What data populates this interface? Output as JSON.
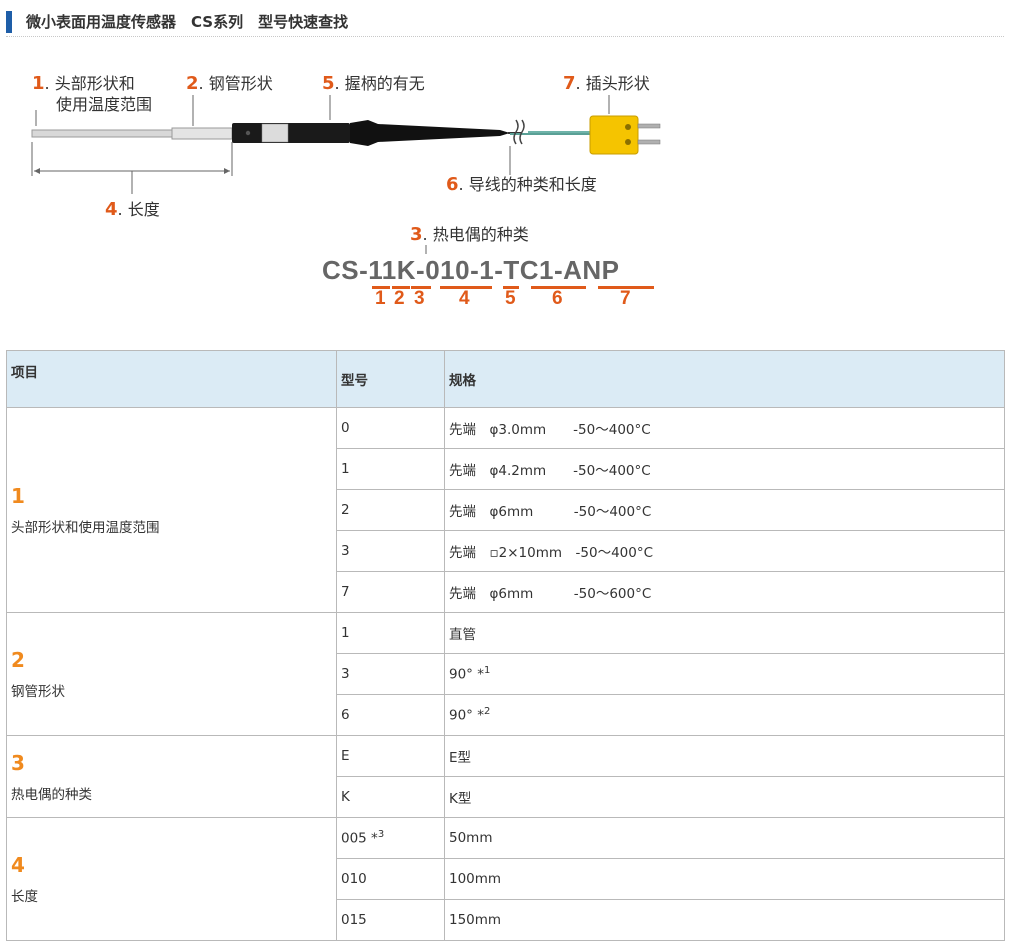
{
  "header": {
    "title": "微小表面用温度传感器　CS系列　型号快速查找"
  },
  "diagram": {
    "label1_num": "1",
    "label1_line1": "头部形状和",
    "label1_line2": "使用温度范围",
    "label2_num": "2",
    "label2_text": "钢管形状",
    "label5_num": "5",
    "label5_text": "握柄的有无",
    "label7_num": "7",
    "label7_text": "插头形状",
    "label4_num": "4",
    "label4_text": "长度",
    "label6_num": "6",
    "label6_text": "导线的种类和长度",
    "label3_num": "3",
    "label3_text": "热电偶的种类",
    "model_code": "CS-11K-010-1-TC1-ANP",
    "segment_numbers": [
      "1",
      "2",
      "3",
      "4",
      "5",
      "6",
      "7"
    ]
  },
  "table": {
    "headers": {
      "item": "项目",
      "model": "型号",
      "spec": "规格"
    },
    "groups": [
      {
        "num": "1",
        "name": "头部形状和使用温度范围",
        "rows": [
          {
            "model": "0",
            "spec": "先端　φ3.0mm　　-50～400°C"
          },
          {
            "model": "1",
            "spec": "先端　φ4.2mm　　-50～400°C"
          },
          {
            "model": "2",
            "spec": "先端　φ6mm　　　-50～400°C"
          },
          {
            "model": "3",
            "spec": "先端　▫2×10mm　-50～400°C"
          },
          {
            "model": "7",
            "spec": "先端　φ6mm　　　-50～600°C"
          }
        ]
      },
      {
        "num": "2",
        "name": "钢管形状",
        "rows": [
          {
            "model": "1",
            "spec": "直管"
          },
          {
            "model": "3",
            "spec": "90° *",
            "sup": "1"
          },
          {
            "model": "6",
            "spec": "90° *",
            "sup": "2"
          }
        ]
      },
      {
        "num": "3",
        "name": "热电偶的种类",
        "rows": [
          {
            "model": "E",
            "spec": "E型"
          },
          {
            "model": "K",
            "spec": "K型"
          }
        ]
      },
      {
        "num": "4",
        "name": "长度",
        "rows": [
          {
            "model": "005 *",
            "model_sup": "3",
            "spec": "50mm"
          },
          {
            "model": "010",
            "spec": "100mm"
          },
          {
            "model": "015",
            "spec": "150mm"
          }
        ]
      }
    ]
  },
  "colors": {
    "accent_orange": "#e05a1a",
    "header_blue": "#1e5ea8",
    "table_header_bg": "#dbebf5",
    "connector_yellow": "#f5c400"
  }
}
